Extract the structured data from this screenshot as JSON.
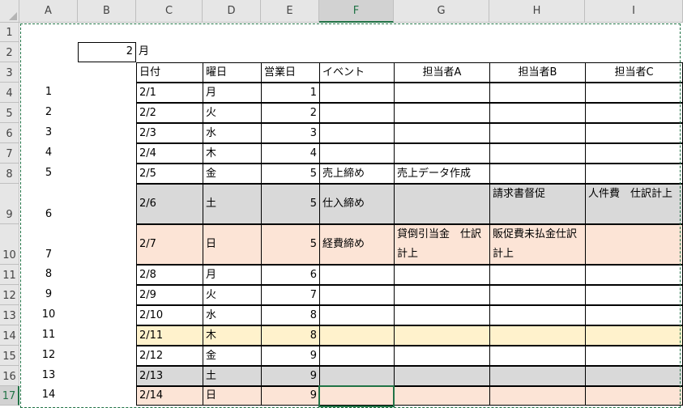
{
  "columns": [
    "A",
    "B",
    "C",
    "D",
    "E",
    "F",
    "G",
    "H",
    "I"
  ],
  "rows": [
    "1",
    "2",
    "3",
    "4",
    "5",
    "6",
    "7",
    "8",
    "9",
    "10",
    "11",
    "12",
    "13",
    "14",
    "15",
    "16",
    "17"
  ],
  "b2_value": "2",
  "c2_label": "月",
  "headers": {
    "date": "日付",
    "weekday": "曜日",
    "bizday": "営業日",
    "event": "イベント",
    "a": "担当者A",
    "b": "担当者B",
    "c": "担当者C"
  },
  "days": [
    {
      "n": "1",
      "date": "2/1",
      "wd": "月",
      "biz": "1",
      "event": "",
      "a": "",
      "b": "",
      "c": "",
      "bg": ""
    },
    {
      "n": "2",
      "date": "2/2",
      "wd": "火",
      "biz": "2",
      "event": "",
      "a": "",
      "b": "",
      "c": "",
      "bg": ""
    },
    {
      "n": "3",
      "date": "2/3",
      "wd": "水",
      "biz": "3",
      "event": "",
      "a": "",
      "b": "",
      "c": "",
      "bg": ""
    },
    {
      "n": "4",
      "date": "2/4",
      "wd": "木",
      "biz": "4",
      "event": "",
      "a": "",
      "b": "",
      "c": "",
      "bg": ""
    },
    {
      "n": "5",
      "date": "2/5",
      "wd": "金",
      "biz": "5",
      "event": "売上締め",
      "a": "売上データ作成",
      "b": "",
      "c": "",
      "bg": ""
    },
    {
      "n": "6",
      "date": "2/6",
      "wd": "土",
      "biz": "5",
      "event": "仕入締め",
      "a": "",
      "b": "請求書督促",
      "c": "人件費　仕訳計上",
      "bg": "bgGray"
    },
    {
      "n": "7",
      "date": "2/7",
      "wd": "日",
      "biz": "5",
      "event": "経費締め",
      "a": "貸倒引当金　仕訳計上",
      "b": "販促費未払金仕訳計上",
      "c": "",
      "bg": "bgPeach"
    },
    {
      "n": "8",
      "date": "2/8",
      "wd": "月",
      "biz": "6",
      "event": "",
      "a": "",
      "b": "",
      "c": "",
      "bg": ""
    },
    {
      "n": "9",
      "date": "2/9",
      "wd": "火",
      "biz": "7",
      "event": "",
      "a": "",
      "b": "",
      "c": "",
      "bg": ""
    },
    {
      "n": "10",
      "date": "2/10",
      "wd": "水",
      "biz": "8",
      "event": "",
      "a": "",
      "b": "",
      "c": "",
      "bg": ""
    },
    {
      "n": "11",
      "date": "2/11",
      "wd": "木",
      "biz": "8",
      "event": "",
      "a": "",
      "b": "",
      "c": "",
      "bg": "bgYellow"
    },
    {
      "n": "12",
      "date": "2/12",
      "wd": "金",
      "biz": "9",
      "event": "",
      "a": "",
      "b": "",
      "c": "",
      "bg": ""
    },
    {
      "n": "13",
      "date": "2/13",
      "wd": "土",
      "biz": "9",
      "event": "",
      "a": "",
      "b": "",
      "c": "",
      "bg": "bgGray"
    },
    {
      "n": "14",
      "date": "2/14",
      "wd": "日",
      "biz": "9",
      "event": "",
      "a": "",
      "b": "",
      "c": "",
      "bg": "bgPeach"
    }
  ],
  "colors": {
    "grid_header_bg": "#e6e6e6",
    "selection": "#217346",
    "gray": "#d9d9d9",
    "peach": "#fce4d6",
    "yellow": "#fff2cc"
  }
}
